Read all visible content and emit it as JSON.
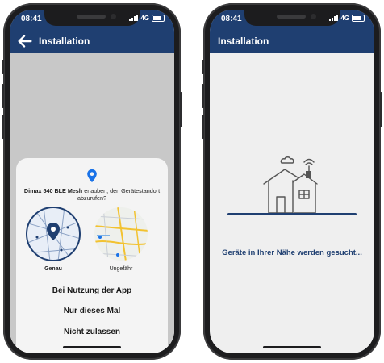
{
  "left_phone": {
    "status": {
      "time": "08:41",
      "network": "4G"
    },
    "appbar": {
      "title": "Installation"
    },
    "permission": {
      "app_name": "Dimax 540 BLE Mesh",
      "message": " erlauben, den Gerätestandort abzurufen?",
      "precise_label": "Genau",
      "approx_label": "Ungefähr",
      "options": [
        "Bei Nutzung der App",
        "Nur dieses Mal",
        "Nicht zulassen"
      ]
    }
  },
  "right_phone": {
    "status": {
      "time": "08:41",
      "network": "4G"
    },
    "appbar": {
      "title": "Installation"
    },
    "searching_text": "Geräte in Ihrer Nähe werden gesucht..."
  },
  "colors": {
    "brand_blue": "#1f3f71",
    "pin_blue": "#1a73e8",
    "overlay_gray": "#c8c8c8"
  },
  "icons": {
    "back": "arrow-left-icon",
    "location_pin": "location-pin-icon",
    "house": "house-wifi-icon"
  }
}
